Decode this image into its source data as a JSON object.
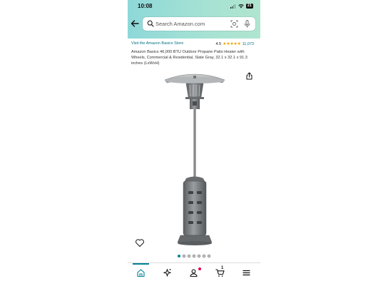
{
  "status_bar": {
    "time": "10:08",
    "battery": "21"
  },
  "search": {
    "placeholder": "Search Amazon.com"
  },
  "product": {
    "store_link": "Visit the Amazon Basics Store",
    "rating_value": "4.5",
    "rating_stars": 4.5,
    "stars_glyphs": "★★★★★",
    "rating_count": "11,073",
    "title": "Amazon Basics 46,000 BTU Outdoor Propane Patio Heater with Wheels, Commercial & Residential, Slate Gray, 32.1 x 32.1 x 91.3 inches (LxWxH)"
  },
  "carousel": {
    "total": 7,
    "active_index": 0
  },
  "bottom_nav": {
    "items": [
      "home-icon",
      "sparkle-icon",
      "account-icon",
      "cart-icon",
      "menu-icon"
    ],
    "cart_count": "1"
  },
  "colors": {
    "header_gradient_start": "#8ed8d9",
    "header_gradient_end": "#b0e5cf",
    "link": "#007185",
    "star": "#f2a100",
    "accent": "#008296",
    "badge": "#e4004b"
  }
}
